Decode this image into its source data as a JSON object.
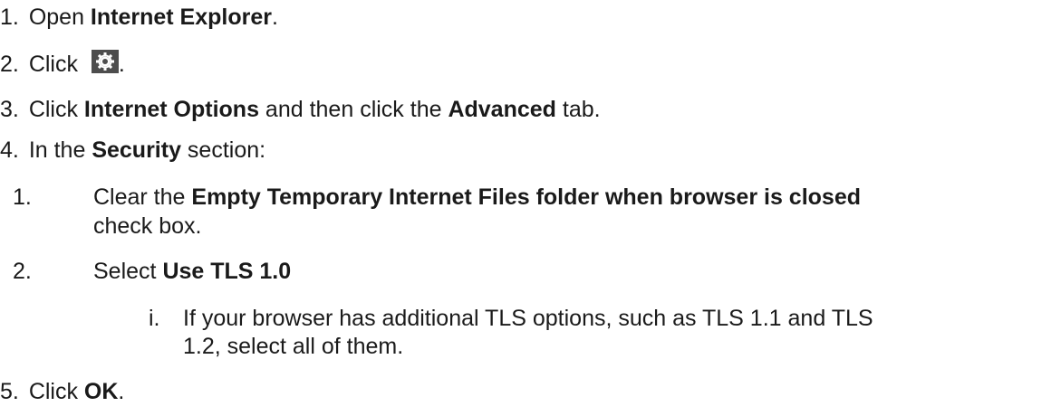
{
  "steps": [
    {
      "num": "1.",
      "pre": "Open ",
      "bold": "Internet Explorer",
      "post": "."
    },
    {
      "num": "2.",
      "pre": "Click ",
      "icon": "gear-icon",
      "post": "."
    },
    {
      "num": "3.",
      "pre": "Click ",
      "bold": "Internet Options",
      "mid": " and then click the ",
      "bold2": "Advanced",
      "post": " tab."
    },
    {
      "num": "4.",
      "pre": "In the ",
      "bold": "Security",
      "post": " section:"
    },
    {
      "num": "5.",
      "pre": "Click ",
      "bold": "OK",
      "post": "."
    }
  ],
  "substeps": [
    {
      "num": "1.",
      "pre": "Clear the ",
      "bold": "Empty Temporary Internet Files folder when browser is closed",
      "cont": "check box."
    },
    {
      "num": "2.",
      "pre": "Select ",
      "bold": "Use TLS 1.0"
    }
  ],
  "subsub": {
    "num": "i.",
    "line1": "If your browser has additional TLS options, such as TLS 1.1 and TLS",
    "line2": "1.2, select all of them."
  },
  "icon_color": "#4d4d4d"
}
